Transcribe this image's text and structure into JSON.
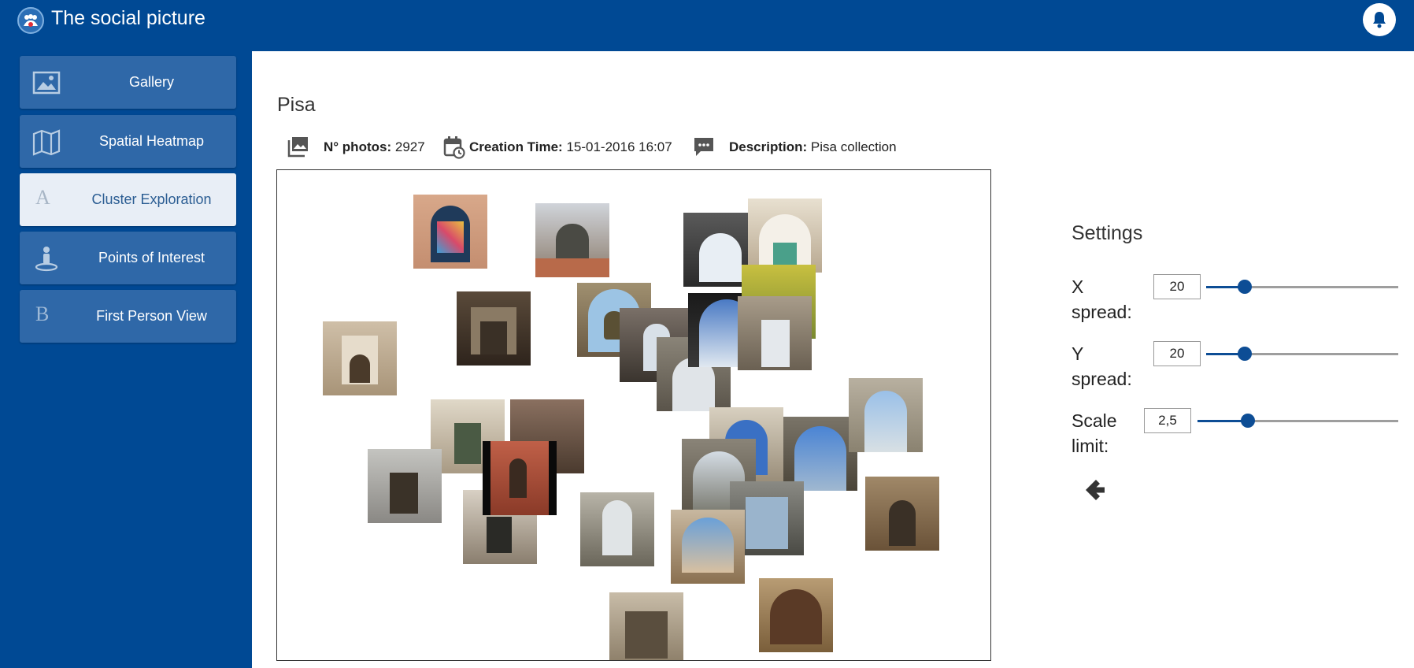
{
  "app": {
    "title": "The social picture"
  },
  "icons": {
    "logo": "app-logo-icon",
    "bell": "bell-icon",
    "back": "arrow-left-icon"
  },
  "sidebar": {
    "items": [
      {
        "label": "Gallery",
        "icon": "image-icon",
        "active": false
      },
      {
        "label": "Spatial Heatmap",
        "icon": "map-icon",
        "active": false
      },
      {
        "label": "Cluster Exploration",
        "icon": "letter-a-icon",
        "glyph": "A",
        "active": true
      },
      {
        "label": "Points of Interest",
        "icon": "person-pin-icon",
        "active": false
      },
      {
        "label": "First Person View",
        "icon": "letter-b-icon",
        "glyph": "B",
        "active": false
      }
    ]
  },
  "collection": {
    "title": "Pisa",
    "photos_label": "N° photos:",
    "photos_value": "2927",
    "creation_label": "Creation Time:",
    "creation_value": "15-01-2016 16:07",
    "description_label": "Description:",
    "description_value": "Pisa collection"
  },
  "settings": {
    "title": "Settings",
    "x_spread": {
      "label_line1": "X",
      "label_line2": "spread:",
      "value": "20",
      "level": 0.2
    },
    "y_spread": {
      "label_line1": "Y",
      "label_line2": "spread:",
      "value": "20",
      "level": 0.2
    },
    "scale_limit": {
      "label_line1": "Scale",
      "label_line2": "limit:",
      "value": "2,5",
      "level": 0.25
    }
  },
  "colors": {
    "brand": "#004994",
    "nav_item": "#2f68a8",
    "nav_active": "#e8eef6",
    "slider": "#0d4d95"
  }
}
